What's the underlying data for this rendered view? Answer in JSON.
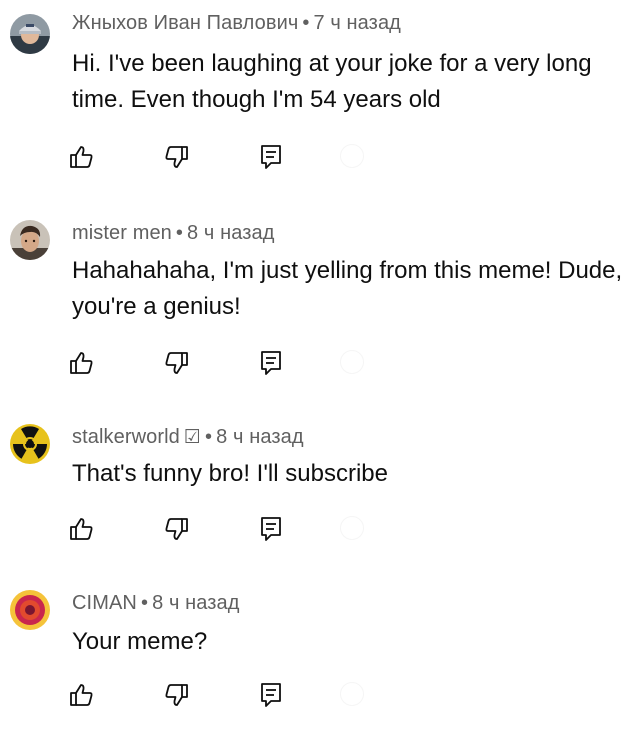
{
  "comments": [
    {
      "author": "Жныхов Иван Павлович",
      "separator": "•",
      "time": "7 ч назад",
      "verified_mark": "",
      "text": "Hi. I've been laughing at your joke for a very long time. Even though I'm 54 years old",
      "avatar": "man-in-cap-photo"
    },
    {
      "author": "mister men",
      "separator": "•",
      "time": "8 ч назад",
      "verified_mark": "",
      "text": "Hahahahaha, I'm just yelling from this meme! Dude, you're a genius!",
      "avatar": "young-man-photo"
    },
    {
      "author": "stalkerworld",
      "separator": "•",
      "time": "8 ч назад",
      "verified_mark": "☑",
      "text": "That's funny bro! I'll subscribe",
      "avatar": "radiation-symbol"
    },
    {
      "author": "CIMAN",
      "separator": "•",
      "time": "8 ч назад",
      "verified_mark": "",
      "text": "Your meme?",
      "avatar": "target-circle"
    }
  ],
  "actions": {
    "like_icon": "thumbs-up-icon",
    "dislike_icon": "thumbs-down-icon",
    "reply_icon": "reply-icon"
  },
  "colors": {
    "meta_text": "#606060",
    "body_text": "#0f0f0f",
    "background": "#ffffff"
  }
}
